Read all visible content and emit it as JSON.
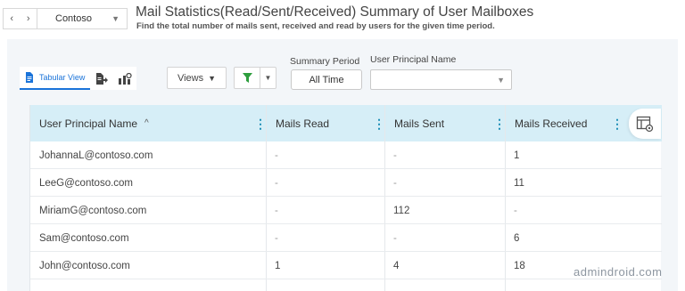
{
  "header": {
    "nav_back": "‹",
    "nav_forward": "›",
    "tenant": "Contoso",
    "title": "Mail Statistics(Read/Sent/Received) Summary of User Mailboxes",
    "subtitle": "Find the total number of mails sent, received and read by users for the given time period."
  },
  "toolbar": {
    "tabular_view_label": "Tabular View",
    "views_label": "Views",
    "summary_period_label": "Summary Period",
    "summary_period_value": "All Time",
    "upn_filter_label": "User Principal Name",
    "upn_filter_value": ""
  },
  "table": {
    "columns": [
      "User Principal Name",
      "Mails Read",
      "Mails Sent",
      "Mails Received"
    ],
    "sort_indicator": "^",
    "rows": [
      [
        "JohannaL@contoso.com",
        "-",
        "-",
        "1"
      ],
      [
        "LeeG@contoso.com",
        "-",
        "-",
        "11"
      ],
      [
        "MiriamG@contoso.com",
        "-",
        "112",
        "-"
      ],
      [
        "Sam@contoso.com",
        "-",
        "-",
        "6"
      ],
      [
        "John@contoso.com",
        "1",
        "4",
        "18"
      ]
    ]
  },
  "watermark": "admindroid.com",
  "colors": {
    "accent": "#1a73d9",
    "header_row": "#d6eef7",
    "filter_green": "#2e9e3e",
    "kebab": "#1f8fb7"
  },
  "icons": {
    "nav": [
      "chevron-left-icon",
      "chevron-right-icon"
    ],
    "tabular": "document-icon",
    "views": [
      "export-report-icon",
      "chart-view-icon"
    ],
    "filter": "funnel-icon",
    "column_chooser": "column-settings-icon"
  }
}
